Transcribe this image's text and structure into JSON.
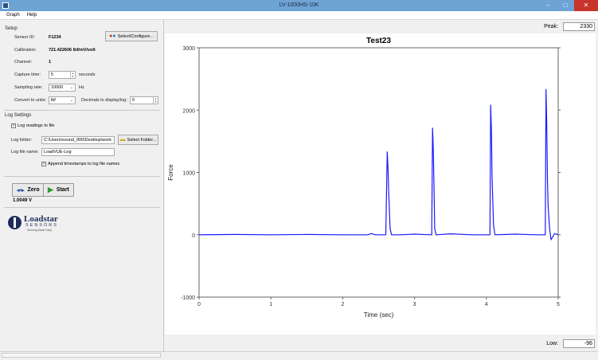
{
  "window": {
    "title": "LV-1000HS-10K",
    "minimize": "–",
    "maximize": "□",
    "close": "✕"
  },
  "menu": {
    "graph": "Graph",
    "help": "Help"
  },
  "setup": {
    "title": "Setup",
    "sensor_id_label": "Sensor ID:",
    "sensor_id": "F1234",
    "select_button": "Select/Configure...",
    "calibration_label": "Calibration:",
    "calibration": "721.422606 lbf/mV/volt",
    "channel_label": "Channel:",
    "channel": "1",
    "capture_label": "Capture time:",
    "capture_value": "5",
    "capture_unit": "seconds",
    "sampling_label": "Sampling rate:",
    "sampling_value": "10000",
    "sampling_unit": "Hz",
    "convert_label": "Convert to units:",
    "convert_value": "lbf",
    "decimals_label": "Decimals to display/log:",
    "decimals_value": "0"
  },
  "log": {
    "title": "Log Settings",
    "log_readings": "Log readings to file",
    "folder_label": "Log folder:",
    "folder_value": "C:\\Users\\sound_000\\Desktop\\work",
    "select_folder_button": "Select Folder...",
    "filename_label": "Log file name:",
    "filename_value": "LoadVUE-Log",
    "append_timestamps": "Append timestamps to log file names"
  },
  "actions": {
    "zero": "Zero",
    "start": "Start",
    "voltage": "1.0049 V"
  },
  "logo": {
    "name": "Loadstar",
    "sub": "SENSORS",
    "tag": "Sensing Made Easy"
  },
  "readouts": {
    "peak_label": "Peak:",
    "peak_value": "2330",
    "low_label": "Low:",
    "low_value": "-96"
  },
  "colors": {
    "series": "#1a1aff",
    "titlebar": "#6ea3d6",
    "close": "#c7342a"
  },
  "chart_data": {
    "type": "line",
    "title": "Test23",
    "xlabel": "Time (sec)",
    "ylabel": "Force",
    "xlim": [
      0,
      5
    ],
    "ylim": [
      -1000,
      3000
    ],
    "xticks": [
      0,
      1,
      2,
      3,
      4,
      5
    ],
    "yticks": [
      -1000,
      0,
      1000,
      2000,
      3000
    ],
    "grid": false,
    "series": [
      {
        "x": [
          0,
          0.5,
          1.0,
          1.5,
          2.0,
          2.35,
          2.4,
          2.45,
          2.6,
          2.62,
          2.63,
          2.64,
          2.66,
          2.68,
          2.8,
          3.0,
          3.24,
          3.25,
          3.26,
          3.27,
          3.28,
          3.3,
          3.5,
          3.8,
          4.05,
          4.06,
          4.07,
          4.08,
          4.1,
          4.12,
          4.4,
          4.7,
          4.82,
          4.83,
          4.84,
          4.85,
          4.86,
          4.88,
          4.9,
          4.95,
          5.0
        ],
        "y": [
          0,
          5,
          0,
          5,
          0,
          0,
          20,
          0,
          0,
          1330,
          1100,
          700,
          100,
          0,
          0,
          10,
          0,
          1710,
          1400,
          800,
          100,
          0,
          15,
          0,
          0,
          2080,
          1700,
          900,
          150,
          0,
          10,
          0,
          0,
          2330,
          1800,
          900,
          450,
          100,
          -80,
          20,
          0
        ]
      }
    ]
  }
}
